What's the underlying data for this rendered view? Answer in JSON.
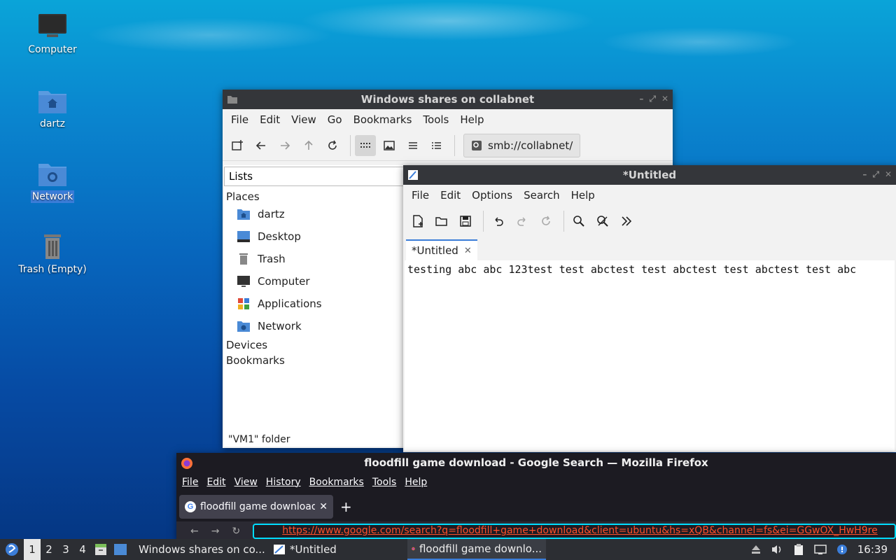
{
  "desktop": {
    "icons": [
      {
        "label": "Computer"
      },
      {
        "label": "dartz"
      },
      {
        "label": "Network"
      },
      {
        "label": "Trash (Empty)"
      }
    ]
  },
  "file_manager": {
    "title": "Windows shares on collabnet",
    "menu": [
      "File",
      "Edit",
      "View",
      "Go",
      "Bookmarks",
      "Tools",
      "Help"
    ],
    "address": "smb://collabnet/",
    "side_mode": "Lists",
    "places_heading": "Places",
    "places": [
      "dartz",
      "Desktop",
      "Trash",
      "Computer",
      "Applications",
      "Network"
    ],
    "devices_heading": "Devices",
    "bookmarks_heading": "Bookmarks",
    "status": "\"VM1\" folder"
  },
  "editor": {
    "title": "*Untitled",
    "menu": [
      "File",
      "Edit",
      "Options",
      "Search",
      "Help"
    ],
    "tab_label": "*Untitled",
    "content": "testing abc abc 123test test abctest test abctest test abctest test abc"
  },
  "browser": {
    "title": "floodfill game download - Google Search — Mozilla Firefox",
    "menu": [
      "File",
      "Edit",
      "View",
      "History",
      "Bookmarks",
      "Tools",
      "Help"
    ],
    "tab_label": "floodfill game download",
    "new_tab": "+",
    "url": "https://www.google.com/search?q=floodfill+game+download&client=ubuntu&hs=xQB&channel=fs&ei=GGwOX_HwH9re"
  },
  "taskbar": {
    "workspaces": [
      "1",
      "2",
      "3",
      "4"
    ],
    "tasks": [
      {
        "label": "Windows shares on co..."
      },
      {
        "label": "*Untitled"
      },
      {
        "label": "floodfill game downlo..."
      }
    ],
    "clock": "16:39"
  },
  "colors": {
    "accent": "#3b7dd8",
    "titlebar": "#34363a",
    "firefox_bg": "#1c1b22",
    "url_text": "#ff4f2a"
  }
}
